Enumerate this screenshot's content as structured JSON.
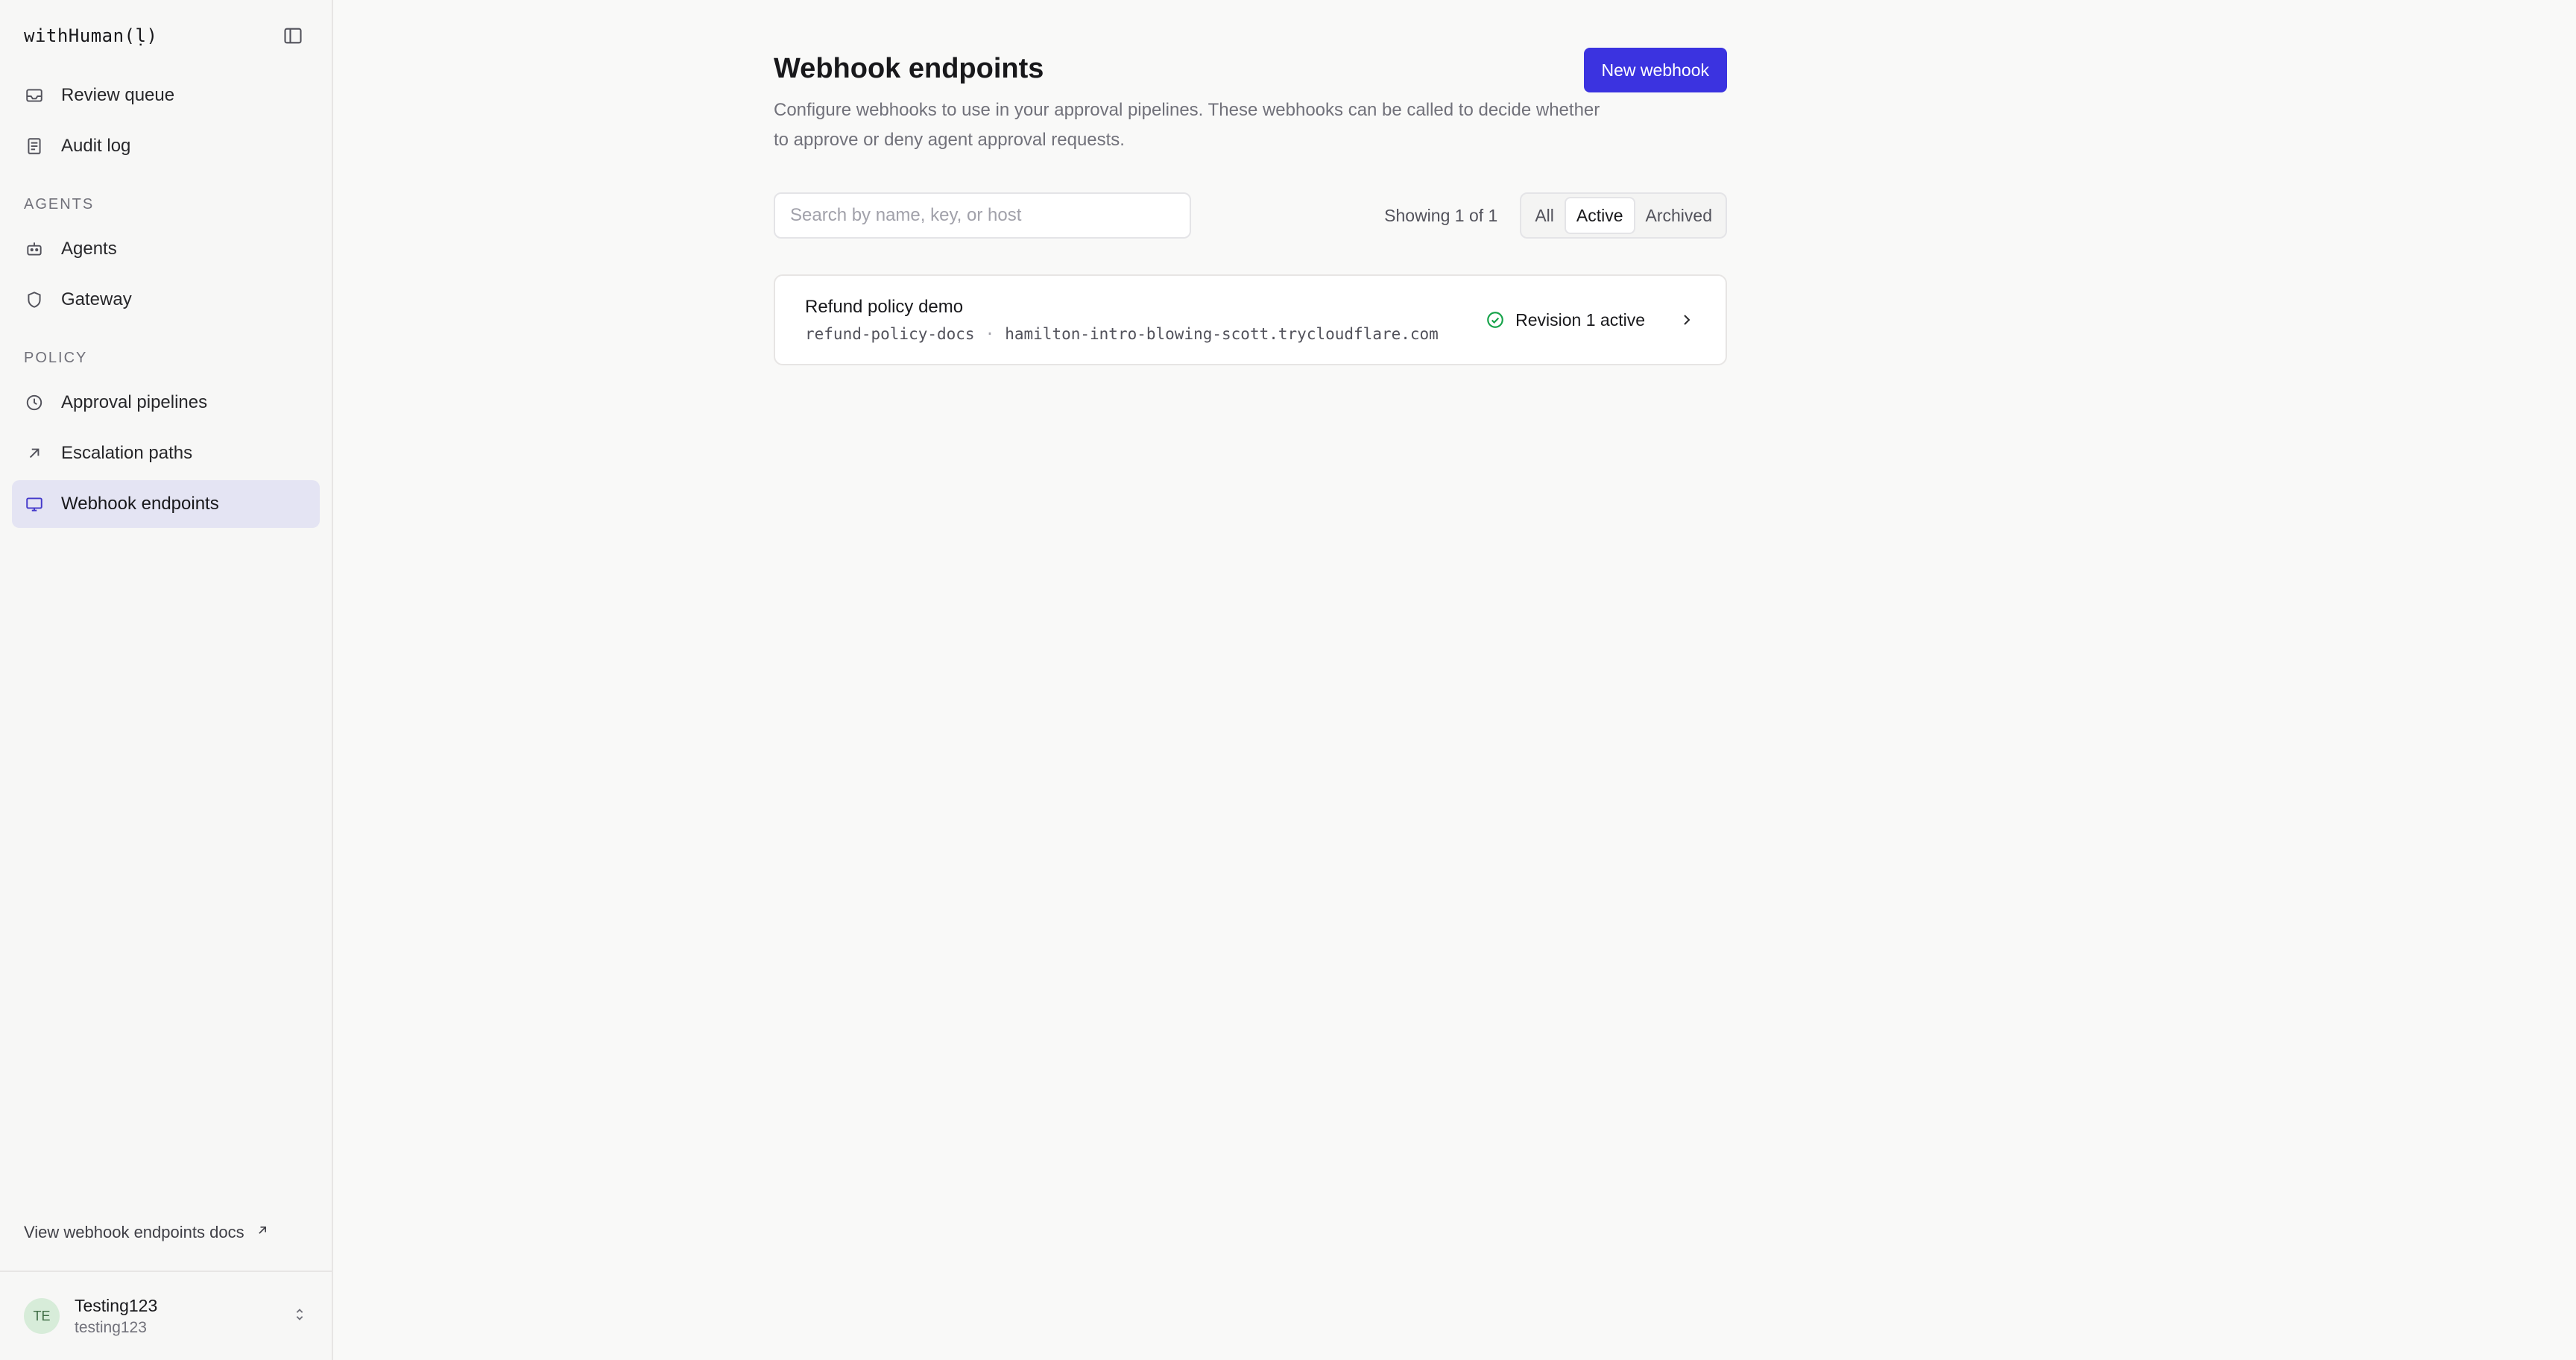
{
  "brand": {
    "name": "withHuman(ḷ)"
  },
  "sidebar": {
    "top_items": [
      {
        "label": "Review queue",
        "icon": "inbox-icon"
      },
      {
        "label": "Audit log",
        "icon": "document-icon"
      }
    ],
    "sections": [
      {
        "label": "AGENTS",
        "items": [
          {
            "label": "Agents",
            "icon": "robot-icon"
          },
          {
            "label": "Gateway",
            "icon": "shield-icon"
          }
        ]
      },
      {
        "label": "POLICY",
        "items": [
          {
            "label": "Approval pipelines",
            "icon": "clock-icon"
          },
          {
            "label": "Escalation paths",
            "icon": "arrow-up-right-icon"
          },
          {
            "label": "Webhook endpoints",
            "icon": "monitor-icon",
            "active": true
          }
        ]
      }
    ],
    "docs_link": "View webhook endpoints docs",
    "user": {
      "initials": "TE",
      "name": "Testing123",
      "handle": "testing123"
    }
  },
  "page": {
    "title": "Webhook endpoints",
    "description": "Configure webhooks to use in your approval pipelines. These webhooks can be called to decide whether to approve or deny agent approval requests.",
    "new_button": "New webhook",
    "search_placeholder": "Search by name, key, or host",
    "showing": "Showing 1 of 1",
    "filters": [
      "All",
      "Active",
      "Archived"
    ],
    "active_filter": "Active"
  },
  "webhooks": [
    {
      "name": "Refund policy demo",
      "key": "refund-policy-docs",
      "separator": "·",
      "host": "hamilton-intro-blowing-scott.trycloudflare.com",
      "status": "Revision 1 active"
    }
  ],
  "colors": {
    "accent": "#3b33e0",
    "active_nav_bg": "#e4e4f3",
    "status_green": "#16a34a"
  }
}
